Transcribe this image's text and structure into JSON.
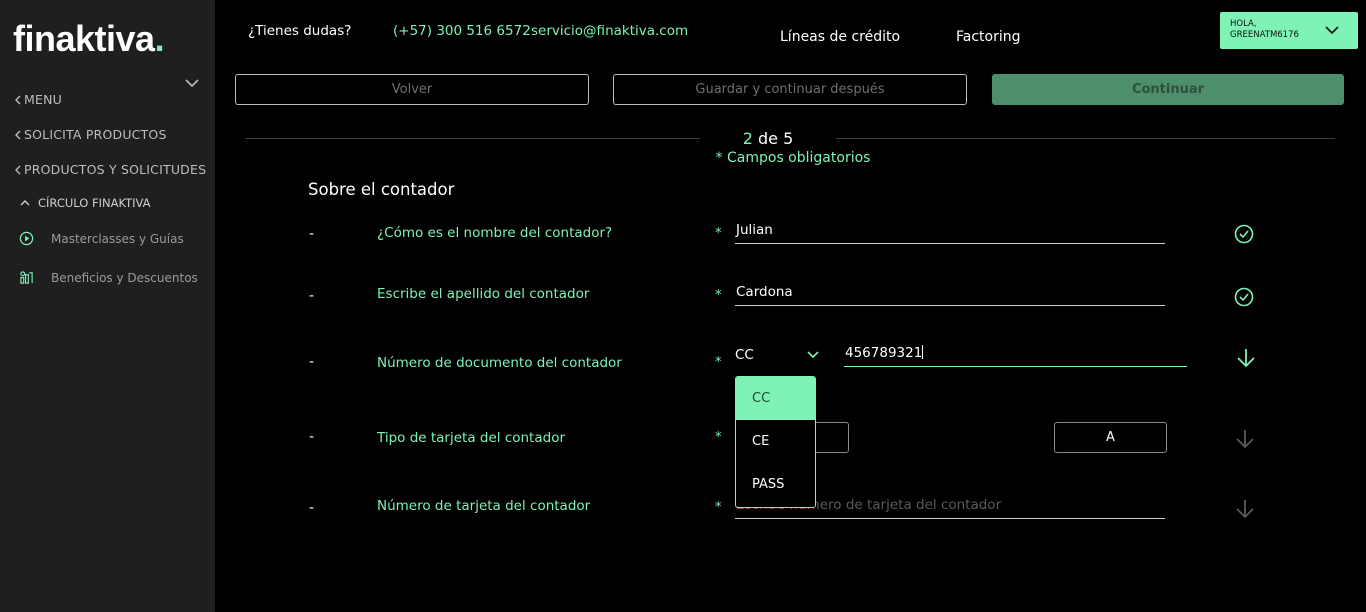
{
  "brand": {
    "name": "finaktiva",
    "dot": "."
  },
  "sidebar": {
    "menu_label": "MENU",
    "items": [
      {
        "label": "SOLICITA PRODUCTOS"
      },
      {
        "label": "PRODUCTOS Y SOLICITUDES"
      }
    ],
    "circle": {
      "label": "CÍRCULO FINAKTIVA",
      "links": [
        {
          "label": "Masterclasses y Guías",
          "icon": "play-circle-icon"
        },
        {
          "label": "Beneficios y Descuentos",
          "icon": "benefits-icon"
        }
      ]
    }
  },
  "header": {
    "question": "¿Tienes dudas?",
    "phone": "(+57) 300 516 6572",
    "email": "servicio@finaktiva.com",
    "nav": [
      "Líneas de crédito",
      "Factoring"
    ],
    "greeting_line1": "HOLA,",
    "greeting_line2": "GREENATM6176"
  },
  "actions": {
    "back": "Volver",
    "save_later": "Guardar y continuar después",
    "continue": "Continuar"
  },
  "progress": {
    "current": "2",
    "separator": "de",
    "total": "5",
    "required_note": "* Campos obligatorios"
  },
  "form": {
    "section_title": "Sobre el contador",
    "dash": "-",
    "star": "*",
    "rows": [
      {
        "label": "¿Cómo es el nombre del contador?",
        "value": "Julian",
        "status": "check-circle-icon"
      },
      {
        "label": "Escribe el apellido del contador",
        "value": "Cardona",
        "status": "check-circle-icon"
      },
      {
        "label": "Número de documento del contador",
        "doc_type": "CC",
        "value": "456789321",
        "status": "arrow-down-icon"
      },
      {
        "label": "Tipo de tarjeta del contador",
        "option_b": "A",
        "status": "arrow-down-icon"
      },
      {
        "label": "Número de tarjeta del contador",
        "placeholder": "Escribe número de tarjeta del contador",
        "status": "arrow-down-icon"
      }
    ],
    "doc_options": [
      "CC",
      "CE",
      "PASS"
    ]
  },
  "colors": {
    "accent": "#7ff2b5",
    "sidebar": "#1f1f1f",
    "background": "#000000",
    "continue_button": "#4d8e6b"
  }
}
